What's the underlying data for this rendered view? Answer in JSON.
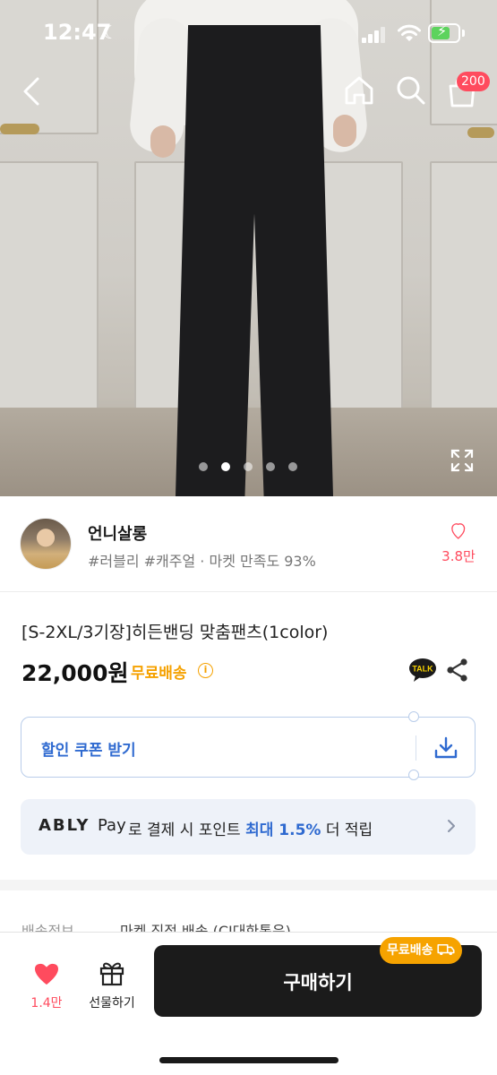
{
  "status_bar": {
    "time": "12:47",
    "moon": "☾",
    "battery_level_fraction": 0.7
  },
  "nav": {
    "cart_badge": "200"
  },
  "gallery": {
    "image_count": 5,
    "active_index": 1
  },
  "seller": {
    "name": "언니살롱",
    "tags": "#러블리 #캐주얼 · 마켓 만족도 93%",
    "like_count": "3.8만"
  },
  "product": {
    "title": "[S-2XL/3기장]히든밴딩 맞춤팬츠(1color)",
    "price": "22,000원",
    "free_shipping": "무료배송",
    "info_symbol": "i",
    "talk_label": "TALK"
  },
  "coupon": {
    "label": "할인 쿠폰 받기"
  },
  "pay_banner": {
    "logo": "ABLY",
    "pay": "Pay",
    "text_before": "로 결제 시 포인트 ",
    "highlight": "최대 1.5%",
    "text_after": " 더 적립"
  },
  "shipping": {
    "label": "배송정보",
    "value": "마켓 직접 배송 (CJ대한통운)"
  },
  "bottom_bar": {
    "like_count": "1.4만",
    "gift_label": "선물하기",
    "buy_label": "구매하기",
    "ship_badge": "무료배송"
  },
  "colors": {
    "accent_pink": "#ff4b5e",
    "free_ship_orange": "#f5a100",
    "coupon_blue": "#2f6ad0",
    "buy_button": "#1b1b1b"
  },
  "icons": [
    "back-icon",
    "home-icon",
    "search-icon",
    "cart-icon",
    "expand-icon",
    "heart-icon",
    "kakao-talk-icon",
    "share-icon",
    "download-icon",
    "chevron-right-icon",
    "gift-icon",
    "truck-icon"
  ]
}
